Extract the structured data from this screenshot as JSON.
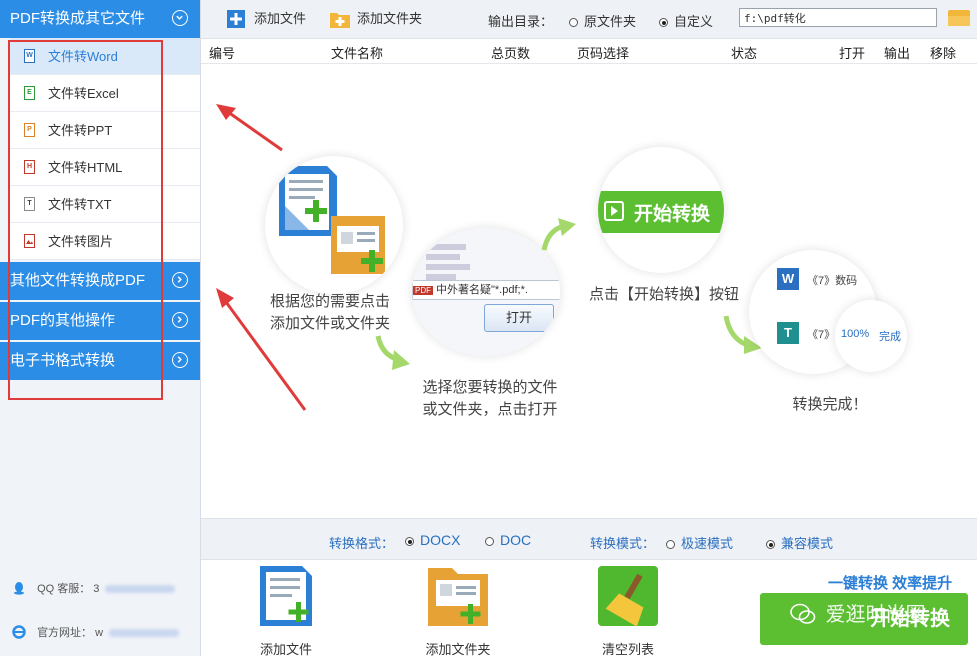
{
  "sidebar": {
    "section1": "PDF转换成其它文件",
    "items": [
      {
        "label": "文件转Word",
        "icon": "W"
      },
      {
        "label": "文件转Excel",
        "icon": "E"
      },
      {
        "label": "文件转PPT",
        "icon": "P"
      },
      {
        "label": "文件转HTML",
        "icon": "H"
      },
      {
        "label": "文件转TXT",
        "icon": "T"
      },
      {
        "label": "文件转图片",
        "icon": "img"
      }
    ],
    "section2": "其他文件转换成PDF",
    "section3": "PDF的其他操作",
    "section4": "电子书格式转换",
    "qq_label": "QQ 客服：",
    "qq_value": "3",
    "site_label": "官方网址：",
    "site_value": "w"
  },
  "toolbar": {
    "add_file": "添加文件",
    "add_folder": "添加文件夹",
    "output_label": "输出目录：",
    "option_original": "原文件夹",
    "option_custom": "自定义",
    "output_path": "f:\\pdf转化"
  },
  "table": {
    "headers": [
      "编号",
      "文件名称",
      "总页数",
      "页码选择",
      "状态",
      "打开",
      "输出",
      "移除"
    ]
  },
  "guide": {
    "step1": [
      "根据您的需要点击",
      "添加文件或文件夹"
    ],
    "step2": [
      "选择您要转换的文件",
      "或文件夹，点击打开"
    ],
    "step2_file": "中外著名疑\"*.pdf;*.",
    "step2_open": "打开",
    "step2_pdf": "PDF",
    "step3": "点击【开始转换】按钮",
    "step3_btn": "开始转换",
    "step4": "转换完成！",
    "step4_row1": "《7》数码",
    "step4_row2": "《7》",
    "step4_progress": "100%",
    "step4_done": "完成"
  },
  "format_bar": {
    "format_label": "转换格式：",
    "docx": "DOCX",
    "doc": "DOC",
    "mode_label": "转换模式：",
    "fast": "极速模式",
    "compat": "兼容模式"
  },
  "actions": {
    "add_file": "添加文件",
    "add_folder": "添加文件夹",
    "clear_list": "清空列表"
  },
  "slogan": "一键转换  效率提升",
  "start_button": "开始转换",
  "watermark": "爱逛时尚圈",
  "colors": {
    "accent": "#2b8de6",
    "green": "#5cbf32",
    "annotation_red": "#e03a3a"
  }
}
